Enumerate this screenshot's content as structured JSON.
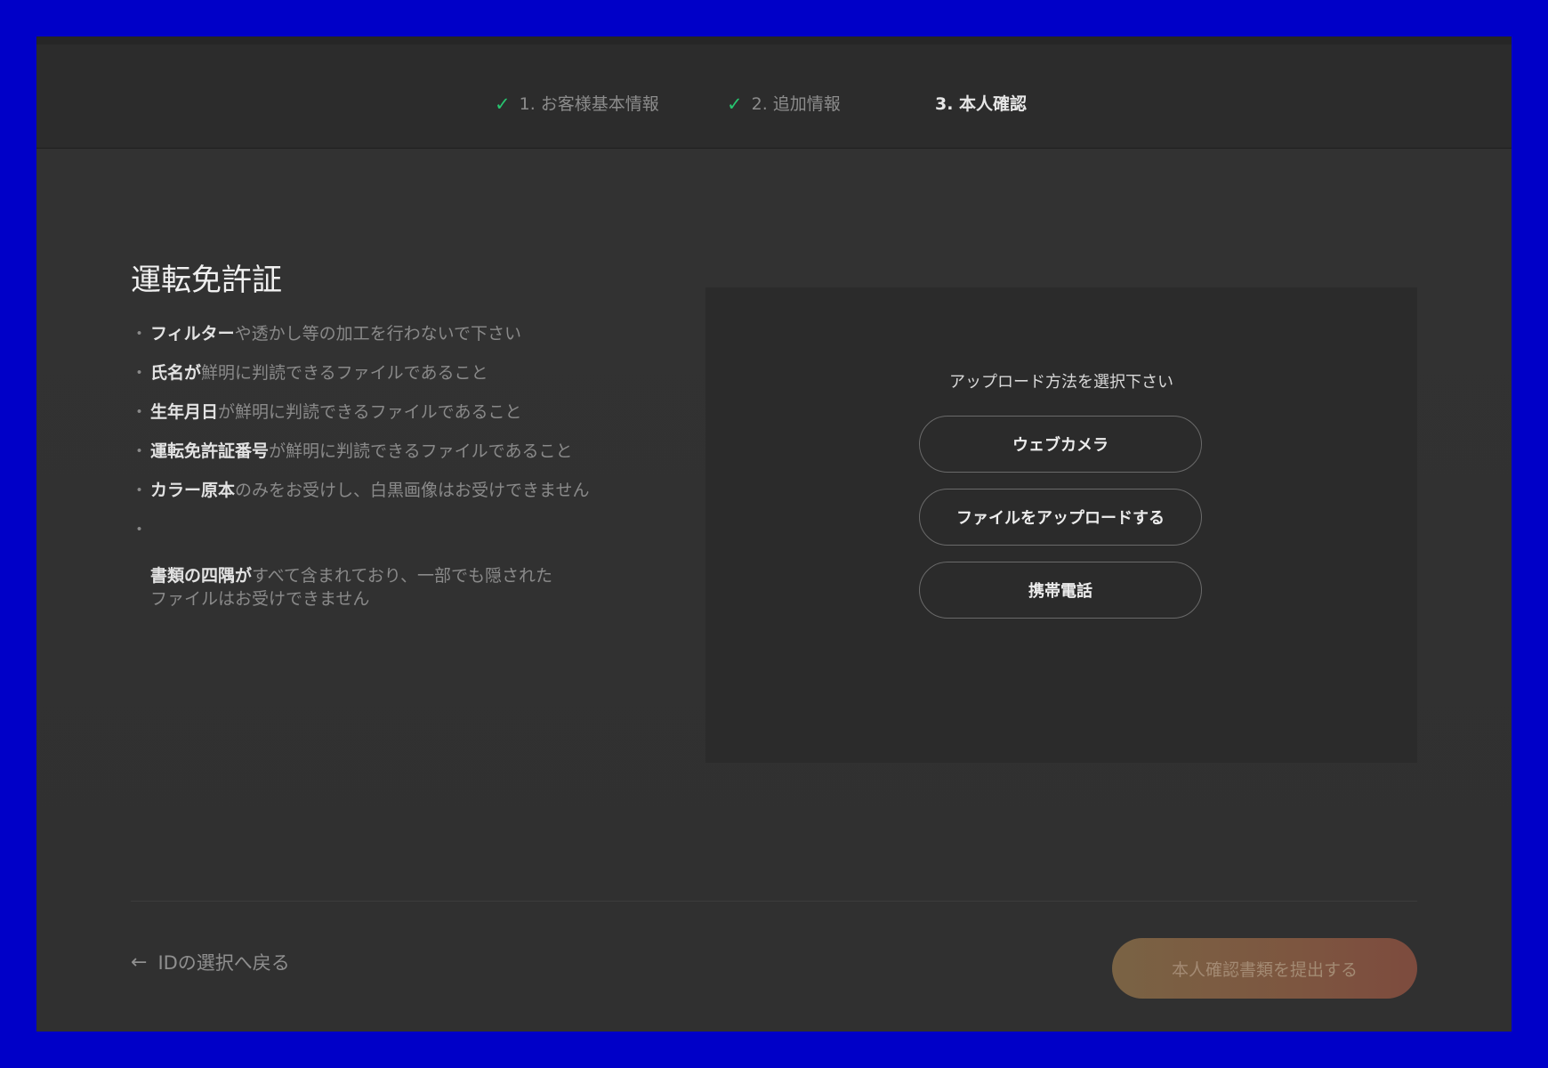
{
  "steps": [
    {
      "label": "1. お客様基本情報",
      "completed": true
    },
    {
      "label": "2. 追加情報",
      "completed": true
    },
    {
      "label": "3. 本人確認",
      "completed": false,
      "active": true
    }
  ],
  "check_glyph": "✓",
  "document": {
    "title": "運転免許証",
    "bullet": "・",
    "requirements": [
      {
        "strong": "フィルター",
        "rest": "や透かし等の加工を行わないで下さい"
      },
      {
        "strong": "氏名が",
        "rest": "鮮明に判読できるファイルであること"
      },
      {
        "strong": "生年月日",
        "rest": "が鮮明に判読できるファイルであること"
      },
      {
        "strong": "運転免許証番号",
        "rest": "が鮮明に判読できるファイルであること"
      },
      {
        "strong": "カラー原本",
        "rest": "のみをお受けし、白黒画像はお受けできません"
      },
      {
        "strong": "書類の四隅が",
        "rest": "すべて含まれており、一部でも隠された\nファイルはお受けできません"
      }
    ]
  },
  "upload": {
    "heading": "アップロード方法を選択下さい",
    "methods": [
      {
        "label": "ウェブカメラ"
      },
      {
        "label": "ファイルをアップロードする"
      },
      {
        "label": "携帯電話"
      }
    ]
  },
  "footer": {
    "back_arrow": "←",
    "back_label": "IDの選択へ戻る",
    "submit_label": "本人確認書類を提出する"
  },
  "colors": {
    "accent_check": "#27c46f",
    "active_underline": "#e0a060",
    "background": "#2f2f2f"
  }
}
